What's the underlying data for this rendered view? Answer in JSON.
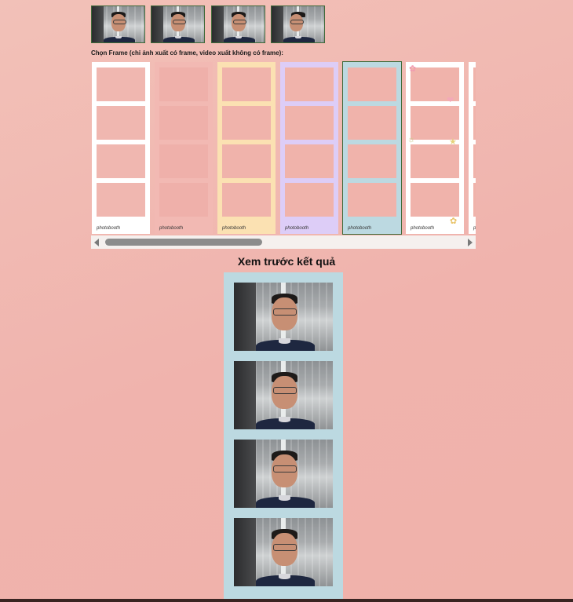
{
  "thumbnails": [
    {
      "name": "thumbnail-1"
    },
    {
      "name": "thumbnail-2"
    },
    {
      "name": "thumbnail-3"
    },
    {
      "name": "thumbnail-4"
    }
  ],
  "frame_section": {
    "label": "Chọn Frame (chỉ ảnh xuất có frame, video xuất không có frame):"
  },
  "frames": [
    {
      "id": "white",
      "bg": "#ffffff",
      "slot": "#f0b7b0",
      "selected": false
    },
    {
      "id": "pink",
      "bg": "#f2b9b3",
      "slot": "#efb0aa",
      "selected": false
    },
    {
      "id": "yellow",
      "bg": "#fbe1b2",
      "slot": "#f0b3ab",
      "selected": false
    },
    {
      "id": "lavender",
      "bg": "#ddcdf7",
      "slot": "#f0b3ab",
      "selected": false
    },
    {
      "id": "light-blue",
      "bg": "#bcd9e1",
      "slot": "#f0b3ab",
      "selected": true
    },
    {
      "id": "cute-stickers",
      "bg": "#ffffff",
      "slot": "#f0b3ab",
      "selected": false
    },
    {
      "id": "partial",
      "bg": "#ffffff",
      "slot": "#f0b3ab",
      "selected": false
    }
  ],
  "frame_brand": "photobooth",
  "preview": {
    "title": "Xem trước kết quả",
    "frame_color": "#bcd9e1"
  },
  "colors": {
    "background": "#f1b6af",
    "scroll_thumb": "#8c8c8c",
    "selected_outline": "#3e6a3a"
  }
}
